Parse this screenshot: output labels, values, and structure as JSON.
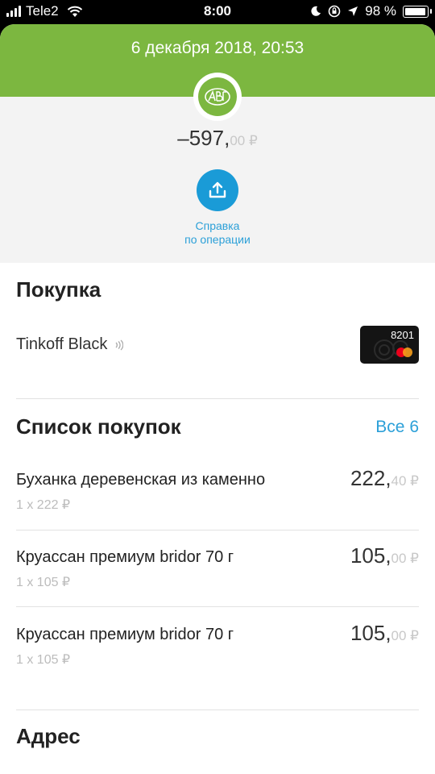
{
  "status": {
    "carrier": "Tele2",
    "time": "8:00",
    "battery": "98 %"
  },
  "header": {
    "date": "6 декабря 2018, 20:53"
  },
  "amount": {
    "main": "–597,",
    "cents": "00 ₽"
  },
  "receipt_action": {
    "line1": "Справка",
    "line2": "по операции"
  },
  "purchase": {
    "title": "Покупка",
    "card_name": "Tinkoff Black",
    "card_last4": "8201"
  },
  "list": {
    "title": "Список покупок",
    "all_label": "Все 6",
    "items": [
      {
        "name": "Буханка деревенская из каменно",
        "qty": "1 x 222 ₽",
        "price_main": "222,",
        "price_cents": "40 ₽"
      },
      {
        "name": "Круассан премиум bridor 70 г",
        "qty": "1 x 105 ₽",
        "price_main": "105,",
        "price_cents": "00 ₽"
      },
      {
        "name": "Круассан премиум bridor 70 г",
        "qty": "1 x 105 ₽",
        "price_main": "105,",
        "price_cents": "00 ₽"
      }
    ]
  },
  "address": {
    "title": "Адрес"
  },
  "colors": {
    "brand_green": "#7cb740",
    "accent_blue": "#1a9bd7",
    "link_blue": "#2ca0d8"
  }
}
